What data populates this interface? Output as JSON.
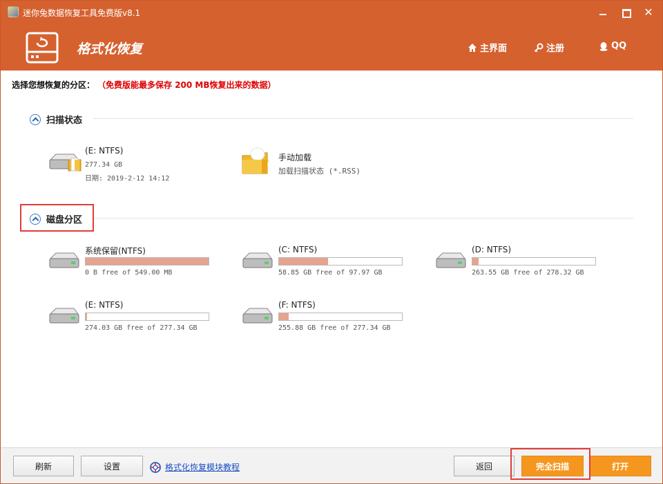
{
  "window": {
    "title": "迷你兔数据恢复工具免费版v8.1",
    "close_glyph": "✕"
  },
  "header": {
    "module_title": "格式化恢复",
    "nav": {
      "home": "主界面",
      "register": "注册",
      "qq": "QQ"
    },
    "bg_color": "#d5612f"
  },
  "prompt": {
    "label": "选择您想恢复的分区：",
    "warning": "（免费版能最多保存 200 MB恢复出来的数据）"
  },
  "scan_status": {
    "title": "扫描状态",
    "items": [
      {
        "name": "(E: NTFS)",
        "size": "277.34 GB",
        "date": "日期: 2019-2-12 14:12"
      },
      {
        "name": "手动加载",
        "desc": "加载扫描状态 (*.RSS)"
      }
    ]
  },
  "partitions": {
    "title": "磁盘分区",
    "drives": [
      {
        "name": "系统保留(NTFS)",
        "free_text": "0 B free of 549.00 MB",
        "used_fraction": 1.0
      },
      {
        "name": "(C: NTFS)",
        "free_text": "58.85 GB free of 97.97 GB",
        "used_fraction": 0.4
      },
      {
        "name": "(D: NTFS)",
        "free_text": "263.55 GB free of 278.32 GB",
        "used_fraction": 0.053
      },
      {
        "name": "(E: NTFS)",
        "free_text": "274.03 GB free of 277.34 GB",
        "used_fraction": 0.012
      },
      {
        "name": "(F: NTFS)",
        "free_text": "255.88 GB free of 277.34 GB",
        "used_fraction": 0.077
      }
    ]
  },
  "bottom": {
    "refresh": "刷新",
    "settings": "设置",
    "help_link": "格式化恢复模块教程",
    "back": "返回",
    "full_scan": "完全扫描",
    "open": "打开"
  },
  "colors": {
    "accent": "#d5612f",
    "primary_button": "#f5971f",
    "usage_fill": "#e6a48f",
    "highlight": "#e23b3b",
    "warning_text": "#e00000"
  }
}
